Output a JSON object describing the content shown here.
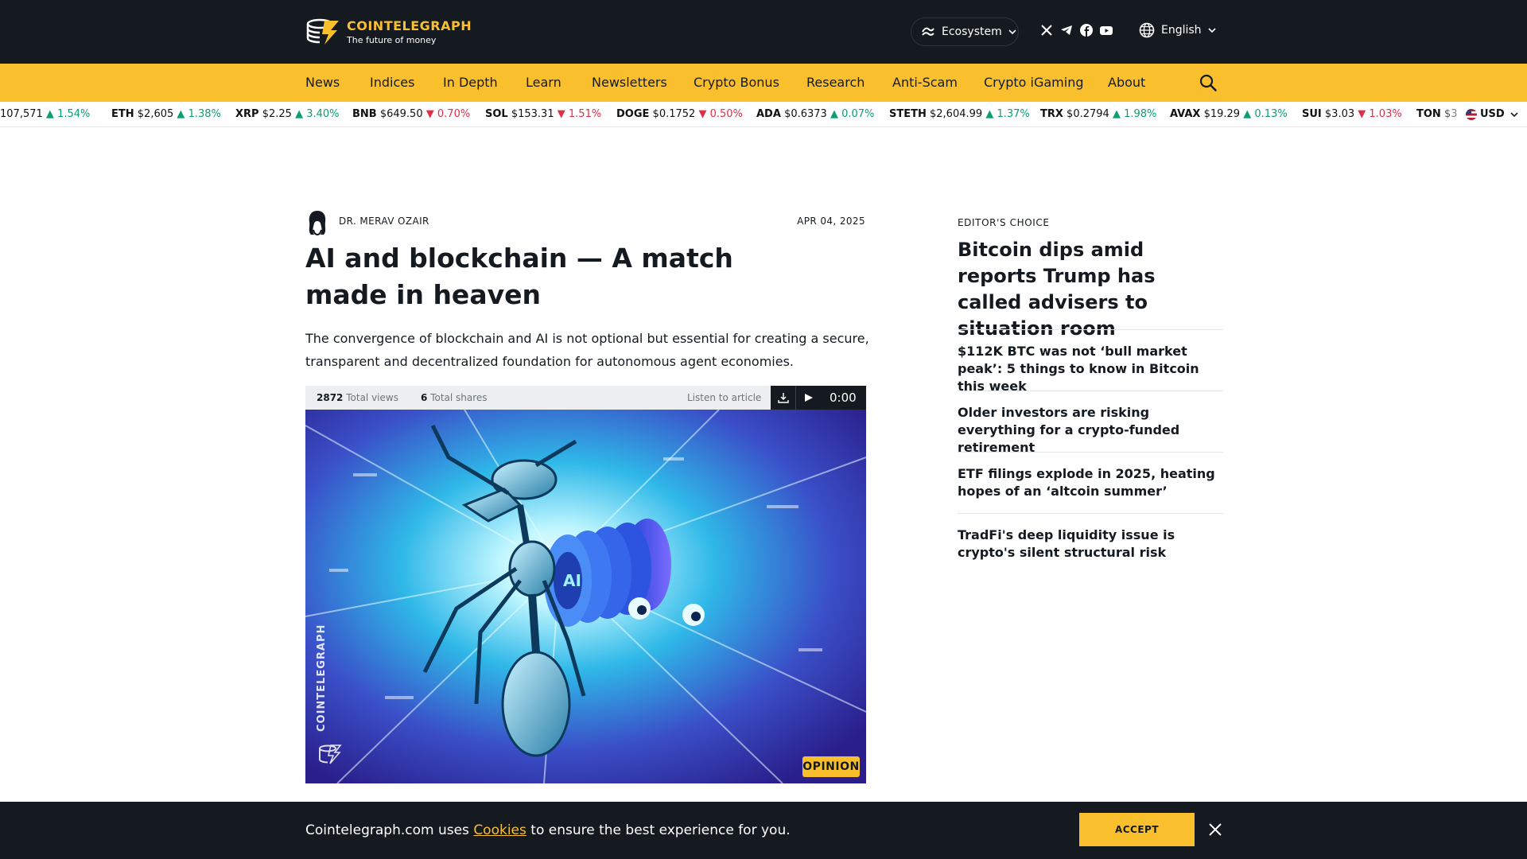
{
  "header": {
    "logo_name": "COINTELEGRAPH",
    "logo_tagline": "The future of money",
    "ecosystem_label": "Ecosystem",
    "language_label": "English",
    "social_icons": [
      "x-icon",
      "telegram-icon",
      "facebook-icon",
      "youtube-icon"
    ],
    "brand_color": "#fabf2c",
    "dark_color": "#141a1f"
  },
  "nav": {
    "items": [
      "News",
      "Indices",
      "In Depth",
      "Learn",
      "Newsletters",
      "Crypto Bonus",
      "Research",
      "Anti-Scam",
      "Crypto iGaming",
      "About"
    ]
  },
  "ticker": {
    "items": [
      {
        "sym": "",
        "price": "107,571",
        "change": "1.54%",
        "dir": "up"
      },
      {
        "sym": "ETH",
        "price": "$2,605",
        "change": "1.38%",
        "dir": "up"
      },
      {
        "sym": "XRP",
        "price": "$2.25",
        "change": "3.40%",
        "dir": "up"
      },
      {
        "sym": "BNB",
        "price": "$649.50",
        "change": "0.70%",
        "dir": "down"
      },
      {
        "sym": "SOL",
        "price": "$153.31",
        "change": "1.51%",
        "dir": "down"
      },
      {
        "sym": "DOGE",
        "price": "$0.1752",
        "change": "0.50%",
        "dir": "down"
      },
      {
        "sym": "ADA",
        "price": "$0.6373",
        "change": "0.07%",
        "dir": "up"
      },
      {
        "sym": "STETH",
        "price": "$2,604.99",
        "change": "1.37%",
        "dir": "up"
      },
      {
        "sym": "TRX",
        "price": "$0.2794",
        "change": "1.98%",
        "dir": "up"
      },
      {
        "sym": "AVAX",
        "price": "$19.29",
        "change": "0.13%",
        "dir": "up"
      },
      {
        "sym": "SUI",
        "price": "$3.03",
        "change": "1.03%",
        "dir": "down"
      },
      {
        "sym": "TON",
        "price": "$3",
        "change": "",
        "dir": ""
      }
    ],
    "currency": "USD"
  },
  "article": {
    "author": "DR. MERAV OZAIR",
    "date": "APR 04, 2025",
    "title": "AI and blockchain — A match made in heaven",
    "lead": "The convergence of blockchain and AI is not optional but essential for creating a secure, transparent and decentralized foundation for autonomous agent economies.",
    "views_count": "2872",
    "views_label": "Total views",
    "shares_count": "6",
    "shares_label": "Total shares",
    "listen_label": "Listen to article",
    "audio_time": "0:00",
    "hero_watermark": "COINTELEGRAPH",
    "badge": "OPINION"
  },
  "sidebar": {
    "label": "EDITOR'S CHOICE",
    "featured_title": "Bitcoin dips amid reports Trump has called advisers to situation room",
    "items": [
      "$112K BTC was not ‘bull market peak’: 5 things to know in Bitcoin this week",
      "Older investors are risking everything for a crypto-funded retirement",
      "ETF filings explode in 2025, heating hopes of an ‘altcoin summer’",
      "TradFi's deep liquidity issue is crypto's silent structural risk"
    ]
  },
  "cookie": {
    "text_before": "Cointelegraph.com uses",
    "link": "Cookies",
    "text_after": "to ensure the best experience for you.",
    "accept_label": "ACCEPT"
  }
}
